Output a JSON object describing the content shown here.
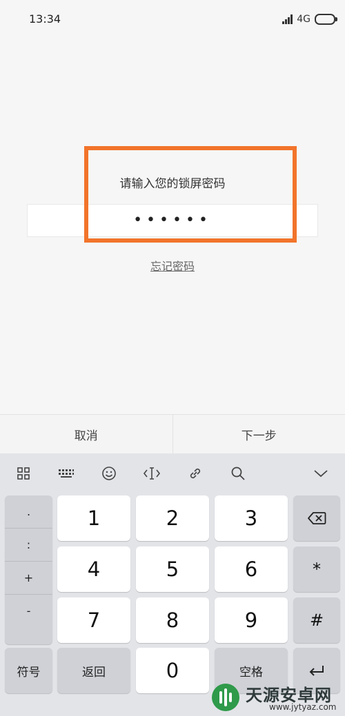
{
  "status_bar": {
    "time": "13:34",
    "network": "4G"
  },
  "lock": {
    "prompt": "请输入您的锁屏密码",
    "password_value": "••••••",
    "forgot_label": "忘记密码"
  },
  "actions": {
    "cancel_label": "取消",
    "next_label": "下一步"
  },
  "keyboard": {
    "toolbar_icons": [
      "grid-icon",
      "keyboard-icon",
      "emoji-icon",
      "cursor-icon",
      "link-icon",
      "search-icon",
      "chevron-down-icon"
    ],
    "symbols": [
      ".",
      ":",
      "+",
      "-"
    ],
    "digits": [
      "1",
      "2",
      "3",
      "4",
      "5",
      "6",
      "7",
      "8",
      "9",
      "0"
    ],
    "right_keys": {
      "asterisk": "*",
      "hash": "#"
    },
    "symbols_label": "符号",
    "back_label": "返回",
    "space_label": "空格"
  },
  "watermark": {
    "name": "天源安卓网",
    "url": "www.jytyaz.com"
  },
  "colors": {
    "highlight": "#f2742b",
    "keyboard_bg": "#e3e4e8"
  }
}
